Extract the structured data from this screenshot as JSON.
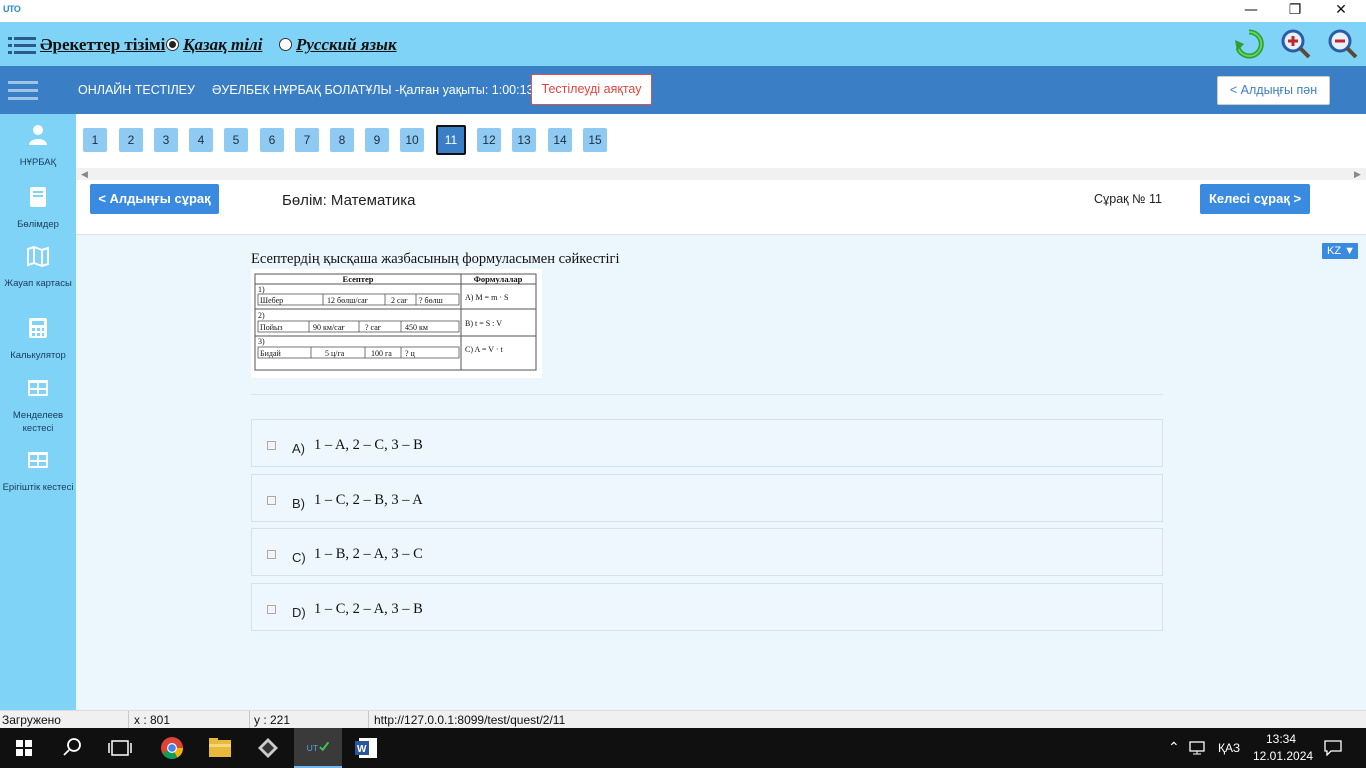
{
  "window": {
    "app_logo": "UTO",
    "minimize": "—",
    "restore": "❐",
    "close": "✕"
  },
  "menubar": {
    "actions_list": "Әрекеттер тізімі",
    "lang_kz": "Қазақ тілі",
    "lang_ru": "Русский язык",
    "lang_selected": "kz"
  },
  "header": {
    "title": "ОНЛАЙН ТЕСТІЛЕУ",
    "student_time": "ӘУЕЛБЕК НҰРБАҚ БОЛАТҰЛЫ -Қалған уақыты: 1:00:13",
    "finish_button": "Тестілеуді аяқтау",
    "prev_subject_button": "< Алдыңғы пән"
  },
  "sidebar": {
    "items": [
      {
        "label": "НҰРБАҚ",
        "icon": "user-icon"
      },
      {
        "label": "Бөлімдер",
        "icon": "book-icon"
      },
      {
        "label": "Жауап картасы",
        "icon": "map-icon"
      },
      {
        "label": "Калькулятор",
        "icon": "calculator-icon"
      },
      {
        "label": "Менделеев кестесі",
        "icon": "table-icon"
      },
      {
        "label": "Ерігіштік кестесі",
        "icon": "table-icon"
      }
    ]
  },
  "question_nav": {
    "numbers": [
      "1",
      "2",
      "3",
      "4",
      "5",
      "6",
      "7",
      "8",
      "9",
      "10",
      "11",
      "12",
      "13",
      "14",
      "15"
    ],
    "current": "11"
  },
  "toolbar": {
    "prev_question": "< Алдыңғы сұрақ",
    "section": "Бөлім: Математика",
    "question_number": "Сұрақ № 11",
    "next_question": "Келесі сұрақ >"
  },
  "language_toggle": "KZ ▼",
  "question": {
    "text": "Есептердің қысқаша жазбасының формуласымен сәйкестігі",
    "image": {
      "col1_header": "Есептер",
      "col2_header": "Формулалар",
      "rows": [
        {
          "num": "1)",
          "cells": [
            "Шебер",
            "12 бөлш/сағ",
            "2 сағ",
            "? бөлш"
          ],
          "formula": "A) M = m · S"
        },
        {
          "num": "2)",
          "cells": [
            "Пойыз",
            "90 км/сағ",
            "? сағ",
            "450 км"
          ],
          "formula": "B) t = S : V"
        },
        {
          "num": "3)",
          "cells": [
            "Бидай",
            "5 ц/га",
            "100 га",
            "? ц"
          ],
          "formula": "C) A = V · t"
        }
      ]
    }
  },
  "answers": [
    {
      "letter": "A)",
      "text": "1 – A, 2 – C, 3 – B"
    },
    {
      "letter": "B)",
      "text": "1 – C, 2 – B, 3 – A"
    },
    {
      "letter": "C)",
      "text": "1 – B, 2 – A, 3 – C"
    },
    {
      "letter": "D)",
      "text": "1 – C, 2 – A, 3 – B"
    }
  ],
  "statusbar": {
    "state": "Загружено",
    "x": "x : 801",
    "y": "y : 221",
    "url": "http://127.0.0.1:8099/test/quest/2/11"
  },
  "taskbar": {
    "lang": "ҚАЗ",
    "time": "13:34",
    "date": "12.01.2024"
  },
  "colors": {
    "accent_light": "#7fd3f7",
    "header_blue": "#3a7fc6",
    "button_blue": "#3a8ae0",
    "finish_red": "#e0443e"
  }
}
